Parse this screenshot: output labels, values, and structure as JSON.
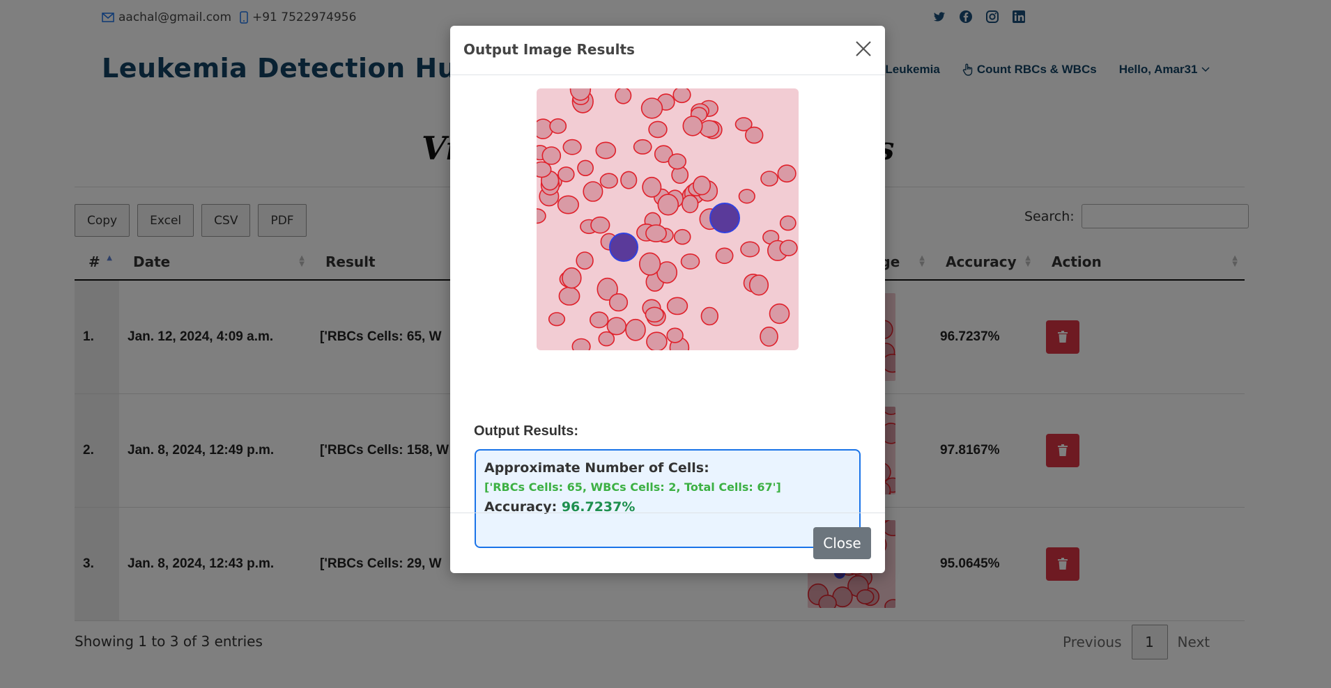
{
  "topbar": {
    "email": "aachal@gmail.com",
    "phone": "+91 7522974956",
    "social": [
      "twitter-icon",
      "facebook-icon",
      "instagram-icon",
      "linkedin-icon"
    ]
  },
  "header": {
    "brand": "Leukemia Detection Hub",
    "nav": {
      "detect_partial": "t Leukemia",
      "count": "Count RBCs & WBCs",
      "user": "Hello, Amar31"
    }
  },
  "page_title_left": "Vi",
  "page_title_right": "ls",
  "toolbar": {
    "buttons": [
      "Copy",
      "Excel",
      "CSV",
      "PDF"
    ],
    "search_label": "Search:"
  },
  "table": {
    "headers": [
      "#",
      "Date",
      "Result",
      "tput Image",
      "Accuracy",
      "Action"
    ],
    "rows": [
      {
        "num": "1.",
        "date": "Jan. 12, 2024, 4:09 a.m.",
        "result": "['RBCs Cells: 65, W",
        "accuracy": "96.7237%"
      },
      {
        "num": "2.",
        "date": "Jan. 8, 2024, 12:49 p.m.",
        "result": "['RBCs Cells: 158, W",
        "accuracy": "97.8167%"
      },
      {
        "num": "3.",
        "date": "Jan. 8, 2024, 12:43 p.m.",
        "result": "['RBCs Cells: 29, W",
        "accuracy": "95.0645%"
      }
    ],
    "info": "Showing 1 to 3 of 3 entries",
    "pager": {
      "previous": "Previous",
      "page": "1",
      "next": "Next"
    }
  },
  "modal": {
    "title": "Output Image Results",
    "output_label": "Output Results:",
    "heading": "Approximate Number of Cells:",
    "cells": "['RBCs Cells: 65, WBCs Cells: 2, Total Cells: 67']",
    "accuracy_label": "Accuracy:",
    "accuracy_value": "96.7237%",
    "close_label": "Close"
  },
  "colors": {
    "brand": "#124265",
    "delete": "#dc3545",
    "result_border": "#1a73e8",
    "cells_green": "#3cb043",
    "accuracy_green": "#1e8f4e",
    "close_btn": "#6c757d"
  }
}
